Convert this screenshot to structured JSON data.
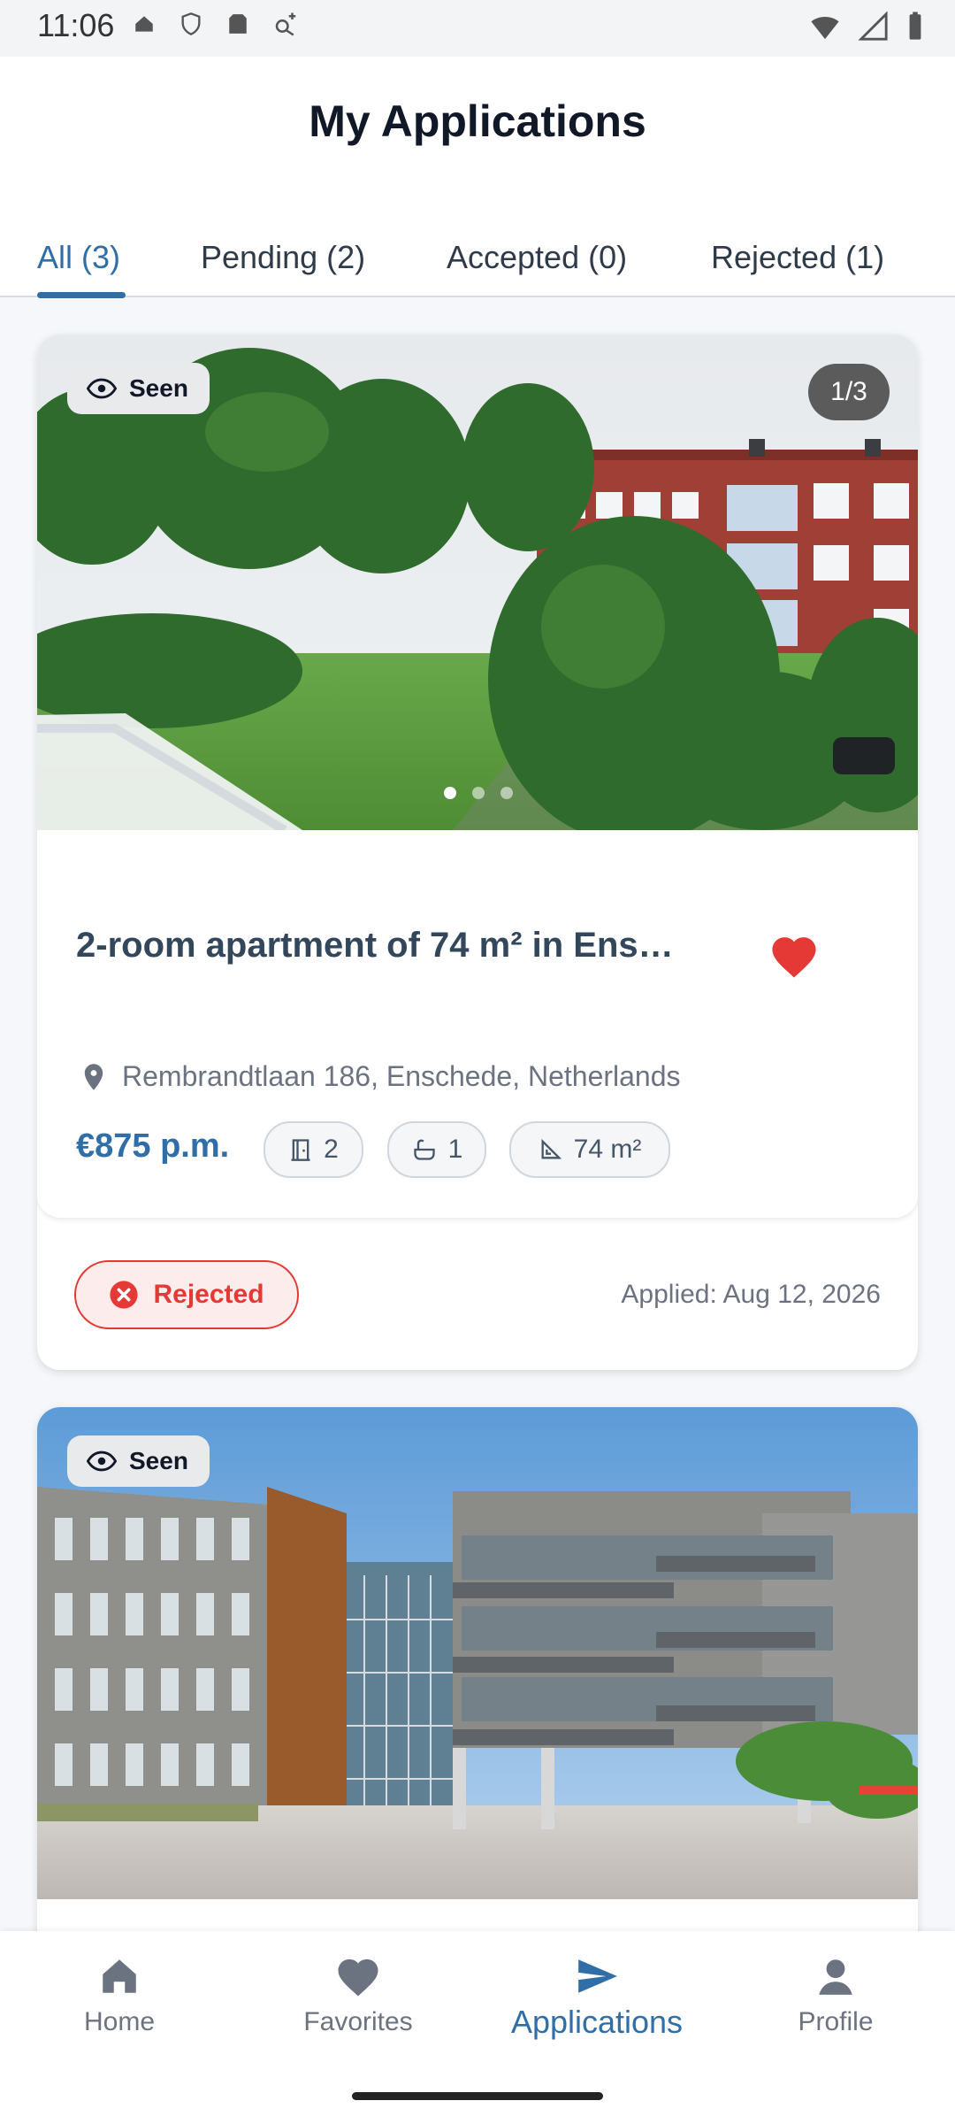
{
  "status_bar": {
    "time": "11:06"
  },
  "header": {
    "title": "My Applications"
  },
  "tabs": [
    {
      "label": "All (3)",
      "active": true
    },
    {
      "label": "Pending (2)",
      "active": false
    },
    {
      "label": "Accepted (0)",
      "active": false
    },
    {
      "label": "Rejected (1)",
      "active": false
    }
  ],
  "applications": [
    {
      "seen_label": "Seen",
      "photo_counter": "1/3",
      "title": "2-room apartment of 74 m² in Ens…",
      "address": "Rembrandtlaan 186, Enschede, Netherlands",
      "price": "€875 p.m.",
      "rooms": "2",
      "bathrooms": "1",
      "size": "74 m²",
      "status": "Rejected",
      "applied": "Applied: Aug 12, 2026"
    },
    {
      "seen_label": "Seen"
    }
  ],
  "bottom_nav": [
    {
      "label": "Home",
      "icon": "home-icon"
    },
    {
      "label": "Favorites",
      "icon": "heart-icon"
    },
    {
      "label": "Applications",
      "icon": "send-icon",
      "active": true
    },
    {
      "label": "Profile",
      "icon": "profile-icon"
    }
  ],
  "colors": {
    "accent": "#2f6ea6",
    "rejected": "#e53935",
    "favorite": "#e53935"
  }
}
